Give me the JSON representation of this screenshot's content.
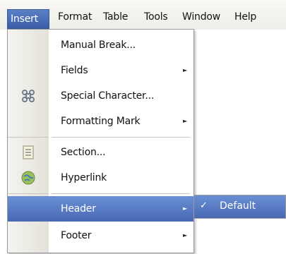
{
  "menubar": {
    "items": [
      {
        "label": "Insert",
        "active": true
      },
      {
        "label": "Format"
      },
      {
        "label": "Table"
      },
      {
        "label": "Tools"
      },
      {
        "label": "Window"
      },
      {
        "label": "Help"
      }
    ]
  },
  "insert_menu": {
    "items": [
      {
        "label": "Manual Break..."
      },
      {
        "label": "Fields",
        "has_submenu": true
      },
      {
        "label": "Special Character...",
        "icon": "special-character-icon"
      },
      {
        "label": "Formatting Mark",
        "has_submenu": true
      },
      {
        "label": "Section...",
        "icon": "section-icon"
      },
      {
        "label": "Hyperlink",
        "icon": "hyperlink-globe-icon"
      },
      {
        "label": "Header",
        "has_submenu": true,
        "highlighted": true
      },
      {
        "label": "Footer",
        "has_submenu": true
      }
    ],
    "arrow_glyph": "►"
  },
  "header_submenu": {
    "items": [
      {
        "label": "Default",
        "checked": true,
        "check_glyph": "✓"
      }
    ]
  },
  "colors": {
    "highlight": "#4f72bd",
    "menu_border": "#9a9a9a",
    "menubar_bg": "#f3f1ec"
  }
}
